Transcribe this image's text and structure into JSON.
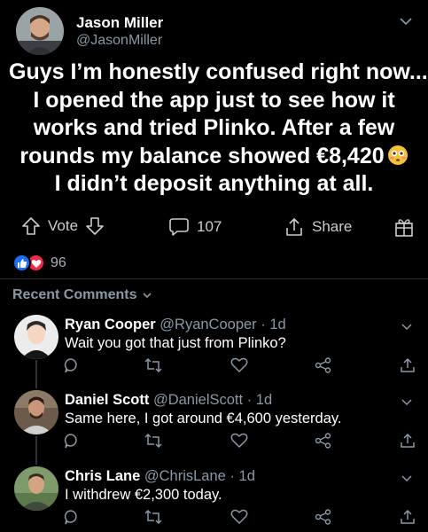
{
  "post": {
    "author": {
      "name": "Jason Miller",
      "handle": "@JasonMiller"
    },
    "lines": [
      "Guys I’m honestly confused right now...",
      "I opened the app just to see how it",
      "works and tried Plinko. After a few",
      "rounds my balance showed €8,420",
      "I didn’t deposit anything at all."
    ],
    "emoji_icon": "flushed-face-emoji"
  },
  "actions": {
    "vote_label": "Vote",
    "comment_count": "107",
    "share_label": "Share"
  },
  "reactions": {
    "count": "96",
    "icons": [
      "like-icon",
      "love-icon"
    ]
  },
  "recent_comments_label": "Recent Comments",
  "comments": [
    {
      "name": "Ryan Cooper",
      "handle": "@RyanCooper",
      "time": "1d",
      "text": "Wait you got that just from Plinko?"
    },
    {
      "name": "Daniel Scott",
      "handle": "@DanielScott",
      "time": "1d",
      "text": "Same here, I got around €4,600 yesterday."
    },
    {
      "name": "Chris Lane",
      "handle": "@ChrisLane",
      "time": "1d",
      "text": "I withdrew €2,300 today."
    }
  ],
  "colors": {
    "background": "#000000",
    "muted": "#8b98a5",
    "like": "#1d6ff2",
    "love": "#f0284a"
  }
}
